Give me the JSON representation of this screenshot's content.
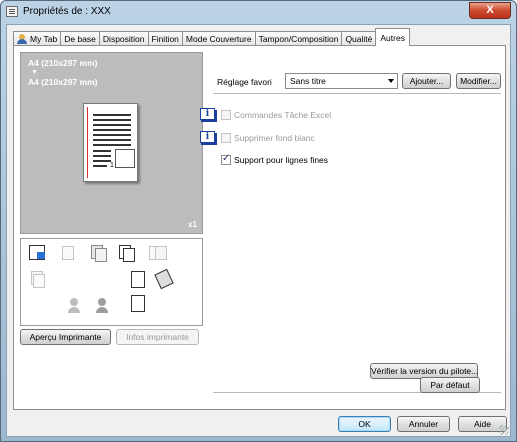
{
  "window": {
    "title": "Propriétés de : XXX",
    "close_label": "X"
  },
  "tabs": [
    {
      "label": "My Tab",
      "icon": "user-icon"
    },
    {
      "label": "De base"
    },
    {
      "label": "Disposition"
    },
    {
      "label": "Finition"
    },
    {
      "label": "Mode Couverture"
    },
    {
      "label": "Tampon/Composition"
    },
    {
      "label": "Qualité"
    },
    {
      "label": "Autres",
      "active": true
    }
  ],
  "preview": {
    "paper_line1": "A4 (210x297 mm)",
    "arrow": "▼",
    "paper_line2": "A4 (210x297 mm)",
    "page_number": "1",
    "copies": "x1"
  },
  "left_buttons": {
    "printer_view": "Aperçu Imprimante",
    "printer_info": "Infos imprimante"
  },
  "favorite": {
    "label": "Réglage favori",
    "value": "Sans titre",
    "add_button": "Ajouter...",
    "modify_button": "Modifier..."
  },
  "options": {
    "excel_commands": {
      "label": "Commandes Tâche Excel",
      "checked": false,
      "enabled": false
    },
    "remove_background": {
      "label": "Supprimer fond blanc",
      "checked": false,
      "enabled": false
    },
    "thin_lines": {
      "label": "Support pour lignes fines",
      "checked": true,
      "enabled": true
    }
  },
  "check_driver_button": "Vérifier la version du pilote...",
  "default_button": "Par défaut",
  "dialog_buttons": {
    "ok": "OK",
    "cancel": "Annuler",
    "help": "Aide"
  },
  "colors": {
    "accent_blue": "#2b6fd6",
    "info_icon": "#1b3fa0",
    "close_red": "#cc4a2f",
    "preview_gray": "#bcbcbc"
  }
}
